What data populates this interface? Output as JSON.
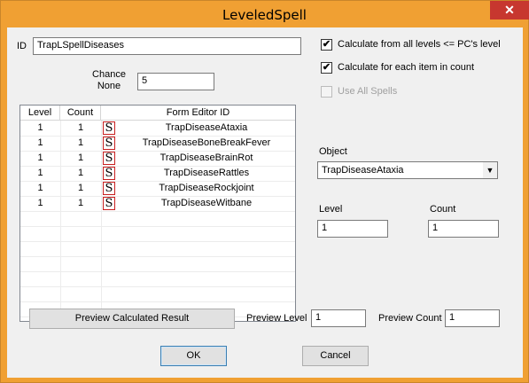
{
  "window": {
    "title": "LeveledSpell",
    "close_glyph": "✕"
  },
  "id_field": {
    "label": "ID",
    "value": "TrapLSpellDiseases"
  },
  "chance_none": {
    "label_line1": "Chance",
    "label_line2": "None",
    "value": "5"
  },
  "options": {
    "calc_all_levels": {
      "label": "Calculate from all levels <= PC's level",
      "checked": true
    },
    "calc_each_item": {
      "label": "Calculate for each item in count",
      "checked": true
    },
    "use_all_spells": {
      "label": "Use All Spells",
      "checked": false,
      "disabled": true
    }
  },
  "table": {
    "columns": [
      "Level",
      "Count",
      "Form Editor ID"
    ],
    "icon_glyph": "S",
    "rows": [
      {
        "level": "1",
        "count": "1",
        "editor_id": "TrapDiseaseAtaxia"
      },
      {
        "level": "1",
        "count": "1",
        "editor_id": "TrapDiseaseBoneBreakFever"
      },
      {
        "level": "1",
        "count": "1",
        "editor_id": "TrapDiseaseBrainRot"
      },
      {
        "level": "1",
        "count": "1",
        "editor_id": "TrapDiseaseRattles"
      },
      {
        "level": "1",
        "count": "1",
        "editor_id": "TrapDiseaseRockjoint"
      },
      {
        "level": "1",
        "count": "1",
        "editor_id": "TrapDiseaseWitbane"
      }
    ]
  },
  "object": {
    "label": "Object",
    "value": "TrapDiseaseAtaxia",
    "arrow_glyph": "▼"
  },
  "level": {
    "label": "Level",
    "value": "1"
  },
  "count": {
    "label": "Count",
    "value": "1"
  },
  "preview": {
    "button_label": "Preview Calculated Result",
    "level_label": "Preview Level",
    "level_value": "1",
    "count_label": "Preview Count",
    "count_value": "1"
  },
  "buttons": {
    "ok": "OK",
    "cancel": "Cancel"
  }
}
